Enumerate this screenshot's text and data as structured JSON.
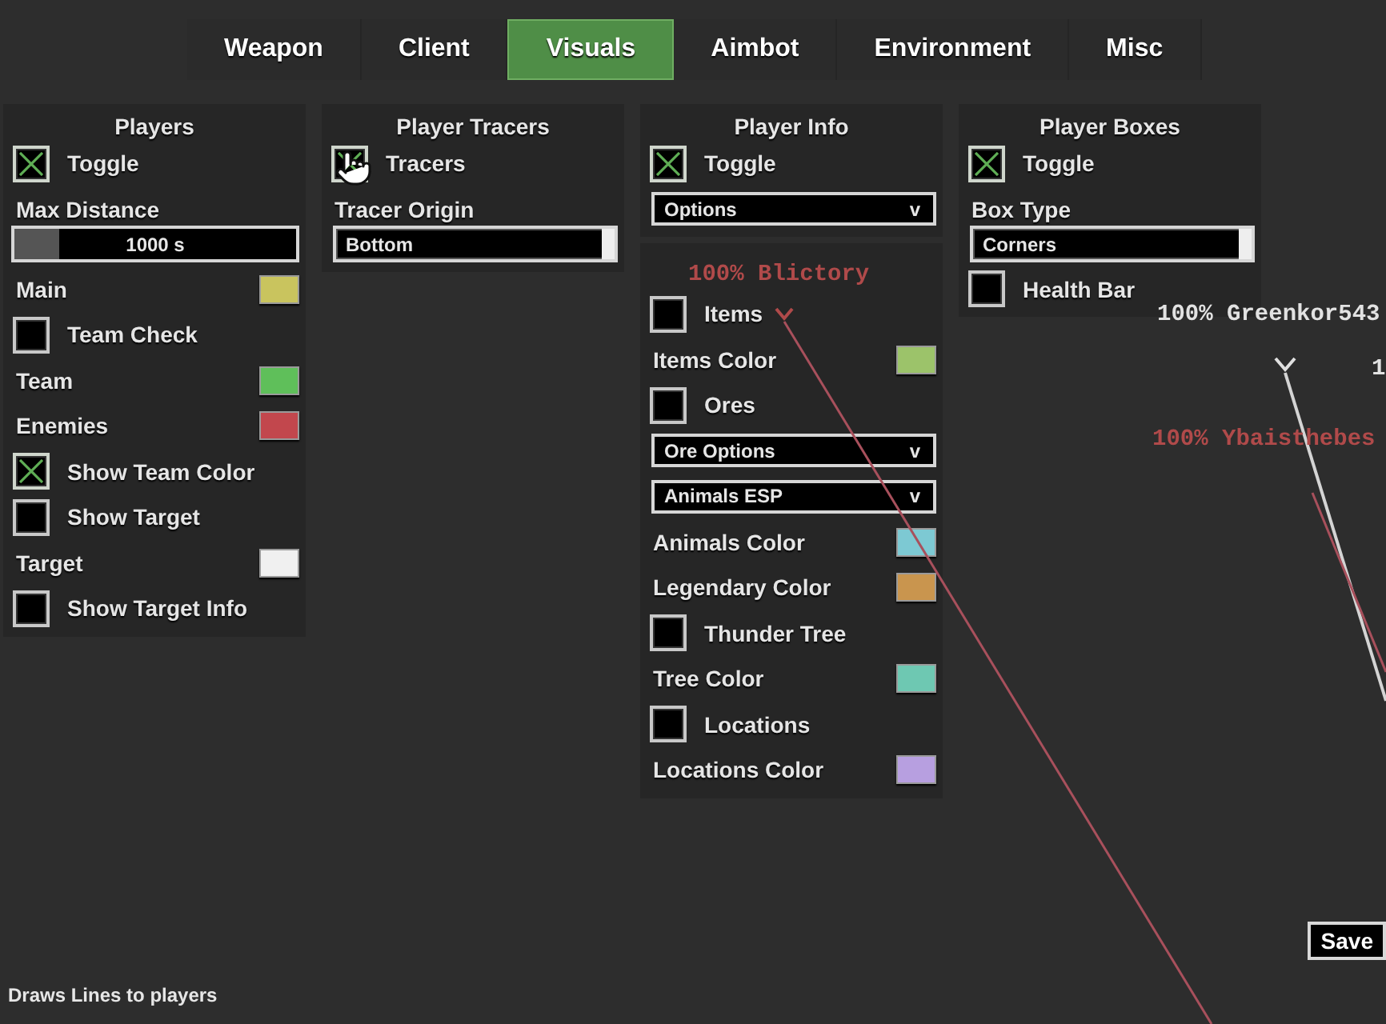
{
  "tabs": [
    {
      "label": "Weapon",
      "selected": false
    },
    {
      "label": "Client",
      "selected": false
    },
    {
      "label": "Visuals",
      "selected": true
    },
    {
      "label": "Aimbot",
      "selected": false
    },
    {
      "label": "Environment",
      "selected": false
    },
    {
      "label": "Misc",
      "selected": false
    }
  ],
  "columns": [
    {
      "panels": [
        {
          "title": "Players",
          "rows": [
            {
              "kind": "checkbox",
              "label": "Toggle",
              "checked": true
            },
            {
              "kind": "label",
              "label": "Max Distance"
            },
            {
              "kind": "slider",
              "value": "1000 s",
              "level": 0.16
            },
            {
              "kind": "color",
              "label": "Main",
              "color": "#c9c45e"
            },
            {
              "kind": "checkbox",
              "label": "Team Check",
              "checked": false
            },
            {
              "kind": "color",
              "label": "Team",
              "color": "#5fbf5a"
            },
            {
              "kind": "color",
              "label": "Enemies",
              "color": "#c2474d"
            },
            {
              "kind": "checkbox",
              "label": "Show Team Color",
              "checked": true
            },
            {
              "kind": "checkbox",
              "label": "Show Target",
              "checked": false
            },
            {
              "kind": "color",
              "label": "Target",
              "color": "#f0f0f0"
            },
            {
              "kind": "checkbox",
              "label": "Show Target Info",
              "checked": false
            }
          ]
        }
      ]
    },
    {
      "panels": [
        {
          "title": "Player Tracers",
          "rows": [
            {
              "kind": "checkbox",
              "label": "Tracers",
              "checked": true
            },
            {
              "kind": "label",
              "label": "Tracer Origin"
            },
            {
              "kind": "selector",
              "value": "Bottom"
            }
          ]
        }
      ]
    },
    {
      "panels": [
        {
          "title": "Player Info",
          "rows": [
            {
              "kind": "checkbox",
              "label": "Toggle",
              "checked": true
            },
            {
              "kind": "dropdown",
              "value": "Options",
              "caret": "v"
            }
          ]
        },
        {
          "rows": [
            {
              "kind": "checkbox",
              "label": "Items",
              "checked": false
            },
            {
              "kind": "color",
              "label": "Items Color",
              "color": "#9cc36a"
            },
            {
              "kind": "checkbox",
              "label": "Ores",
              "checked": false
            },
            {
              "kind": "dropdown",
              "value": "Ore Options",
              "caret": "v"
            },
            {
              "kind": "dropdown",
              "value": "Animals ESP",
              "caret": "v"
            },
            {
              "kind": "color",
              "label": "Animals Color",
              "color": "#7dc9d3"
            },
            {
              "kind": "color",
              "label": "Legendary Color",
              "color": "#c9954e"
            },
            {
              "kind": "checkbox",
              "label": "Thunder Tree",
              "checked": false
            },
            {
              "kind": "color",
              "label": "Tree Color",
              "color": "#6ec8b2"
            },
            {
              "kind": "checkbox",
              "label": "Locations",
              "checked": false
            },
            {
              "kind": "color",
              "label": "Locations Color",
              "color": "#b79fe0"
            }
          ]
        }
      ]
    },
    {
      "panels": [
        {
          "title": "Player Boxes",
          "rows": [
            {
              "kind": "checkbox",
              "label": "Toggle",
              "checked": true
            },
            {
              "kind": "label",
              "label": "Box Type"
            },
            {
              "kind": "selector",
              "value": "Corners"
            },
            {
              "kind": "checkbox",
              "label": "Health Bar",
              "checked": false
            }
          ]
        }
      ]
    }
  ],
  "esp_labels": [
    {
      "text": "100% Blictory",
      "color": "#b04a4a"
    },
    {
      "text": "100% Greenkor543",
      "color": "#e2e2e2"
    },
    {
      "text": "1",
      "color": "#e2e2e2"
    },
    {
      "text": "100% Ybaisthebes",
      "color": "#b04a4a"
    }
  ],
  "buttons": [
    {
      "label": "Save"
    }
  ],
  "status_bar": {
    "text": "Draws Lines to players"
  }
}
